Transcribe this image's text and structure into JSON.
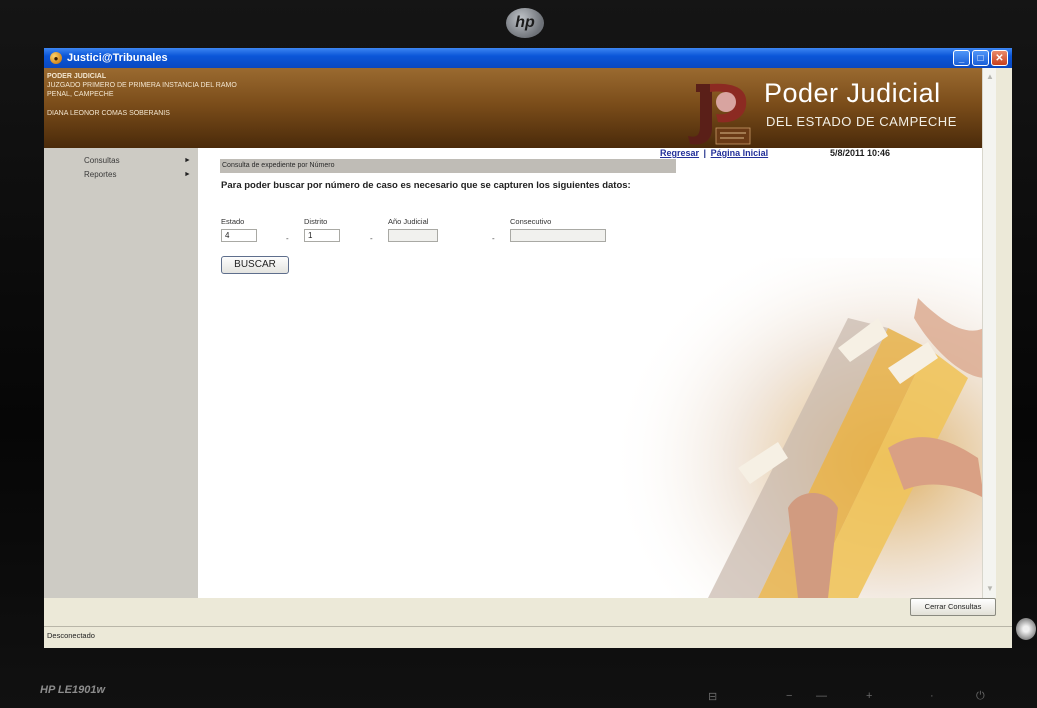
{
  "monitor": {
    "brand": "hp",
    "model": "HP LE1901w",
    "controls": [
      "⊟",
      "−",
      "—",
      "+",
      "·",
      "⏻"
    ]
  },
  "window": {
    "title": "Justici@Tribunales",
    "buttons": {
      "minimize": "_",
      "maximize": "□",
      "close": "✕"
    }
  },
  "banner": {
    "lines": [
      "PODER JUDICIAL",
      "JUZGADO PRIMERO DE PRIMERA INSTANCIA DEL RAMO",
      "PENAL, CAMPECHE"
    ],
    "user": "DIANA LEONOR COMAS SOBERANIS",
    "brand_main": "Poder Judicial",
    "brand_sub": "DEL ESTADO DE CAMPECHE"
  },
  "sidebar": {
    "items": [
      {
        "label": "Consultas",
        "arrow": "►"
      },
      {
        "label": "Reportes",
        "arrow": "►"
      }
    ]
  },
  "nav": {
    "regresar": "Regresar",
    "separator": "|",
    "pagina_inicial": "Página Inicial",
    "datetime": "5/8/2011 10:46"
  },
  "form": {
    "section_title": "Consulta de expediente por Número",
    "instructions": "Para poder buscar por número de caso es necesario que se capturen los siguientes datos:",
    "fields": [
      {
        "label": "Estado",
        "value": "4"
      },
      {
        "label": "Distrito",
        "value": "1"
      },
      {
        "label": "Año Judicial",
        "value": ""
      },
      {
        "label": "Consecutivo",
        "value": ""
      }
    ],
    "separator": "-",
    "search_button": "BUSCAR"
  },
  "footer": {
    "close_button": "Cerrar Consultas",
    "status": "Desconectado"
  },
  "colors": {
    "titlebar": "#0b56d8",
    "banner": "#7b4d1a",
    "sidebar": "#cdcbc4",
    "link": "#23309a",
    "section_header": "#bfbcb6"
  }
}
